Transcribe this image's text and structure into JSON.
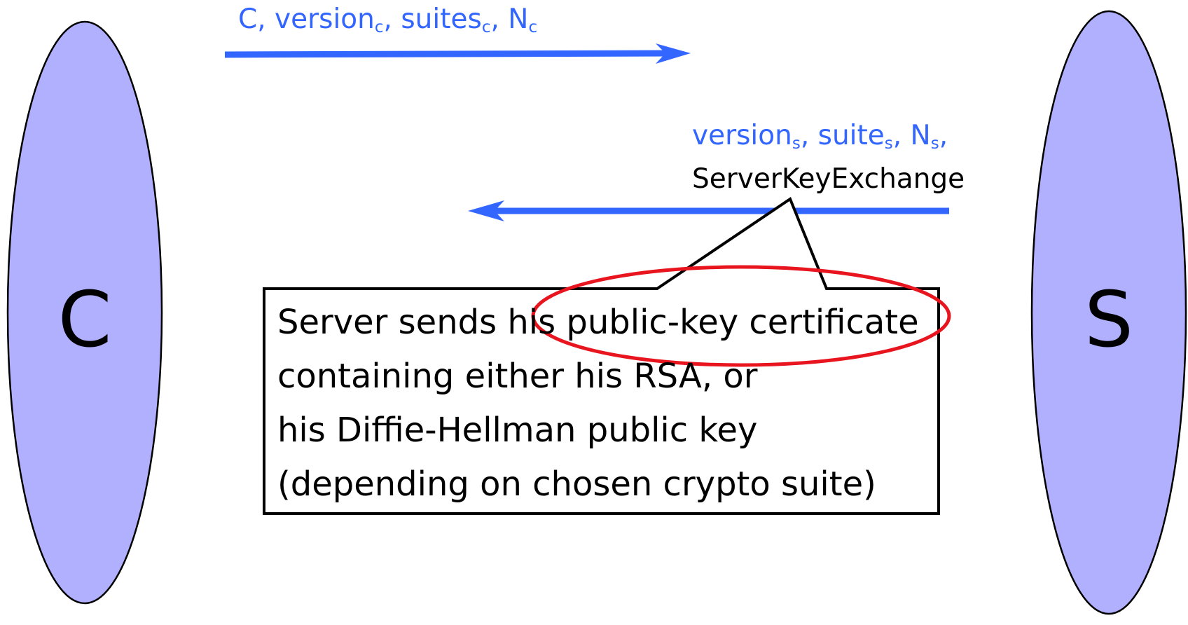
{
  "entities": {
    "client": {
      "label": "C",
      "fill": "#b0b0ff"
    },
    "server": {
      "label": "S",
      "fill": "#b0b0ff"
    }
  },
  "messages": {
    "client_hello": {
      "parts": [
        "C, version",
        "c",
        ", suites",
        "c",
        ", N",
        "c"
      ],
      "color": "#3366ff"
    },
    "server_hello": {
      "line1_parts": [
        "version",
        "s",
        ", suite",
        "s",
        ", N",
        "s",
        ","
      ],
      "line2": "ServerKeyExchange",
      "color": "#3366ff"
    }
  },
  "callout": {
    "lines": [
      "Server sends his public-key certificate",
      "containing either his RSA, or",
      "his Diffie-Hellman public key",
      "(depending on chosen crypto suite)"
    ],
    "highlight": "public-key certificate",
    "highlight_color": "#e8141e"
  }
}
